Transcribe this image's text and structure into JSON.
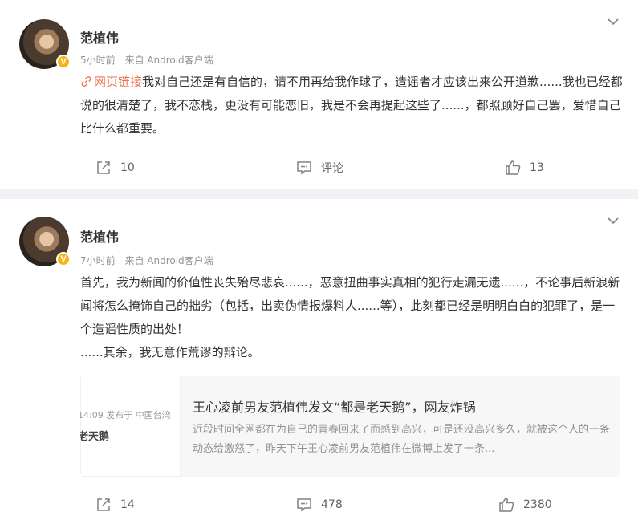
{
  "posts": [
    {
      "author": "范植伟",
      "time": "5小时前",
      "source": "来自 Android客户端",
      "link_label": "网页链接",
      "content": "我对自己还是有自信的，请不用再给我作球了，造谣者才应该出来公开道歉......我也已经都说的很清楚了，我不恋栈，更没有可能恋旧，我是不会再提起这些了......，都照顾好自己罢，爱惜自己比什么都重要。",
      "actions": {
        "share": "10",
        "comment": "评论",
        "like": "13"
      }
    },
    {
      "author": "范植伟",
      "time": "7小时前",
      "source": "来自 Android客户端",
      "content_lines": [
        "首先，我为新闻的价值性丧失殆尽悲哀......，恶意扭曲事实真相的犯行走漏无遗......，不论事后新浪新闻将怎么掩饰自己的拙劣（包括，出卖伪情报爆料人......等），此刻都已经是明明白白的犯罪了，是一个造谣性质的出处！",
        "......其余，我无意作荒谬的辩论。"
      ],
      "card": {
        "thumb_line1": "14:09  发布于 中国台湾",
        "thumb_line2": "老天鹅",
        "title": "王心凌前男友范植伟发文“都是老天鹅”，网友炸锅",
        "desc": "近段时间全网都在为自己的青春回来了而感到高兴，可是还没高兴多久，就被这个人的一条动态给激怒了，昨天下午王心凌前男友范植伟在微博上发了一条..."
      },
      "actions": {
        "share": "14",
        "comment": "478",
        "like": "2380"
      }
    }
  ],
  "verified_badge": "V",
  "colors": {
    "link": "#eb7350",
    "badge": "#f9b316",
    "divider": "#f1f2f5"
  },
  "icons": {
    "share": "share-icon",
    "comment": "comment-icon",
    "like": "like-icon",
    "more": "chevron-down-icon",
    "link": "link-icon"
  }
}
